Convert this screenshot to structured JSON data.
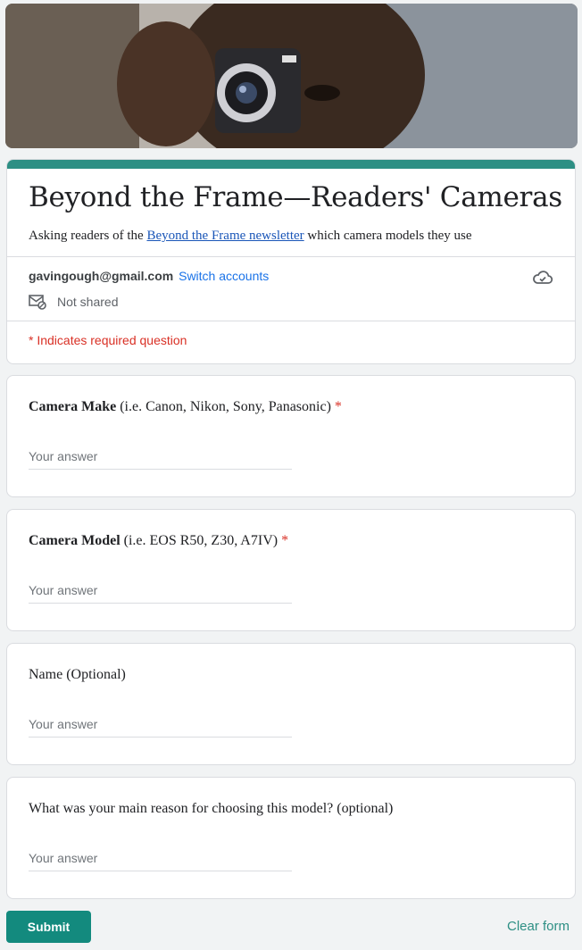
{
  "header": {
    "title": "Beyond the Frame—Readers' Cameras",
    "description_prefix": "Asking readers of the ",
    "description_link": "Beyond the Frame newsletter",
    "description_suffix": " which camera models they use",
    "accent_color": "#2d8f84"
  },
  "account": {
    "email": "gavingough@gmail.com",
    "switch_label": "Switch accounts",
    "shared_status": "Not shared",
    "cloud_icon": "cloud-check-icon"
  },
  "required_note": "* Indicates required question",
  "questions": [
    {
      "label_bold": "Camera Make",
      "label_rest": " (i.e. Canon, Nikon, Sony, Panasonic)",
      "required_mark": "*",
      "placeholder": "Your answer"
    },
    {
      "label_bold": "Camera Model",
      "label_rest": " (i.e. EOS R50, Z30, A7IV)",
      "required_mark": "*",
      "placeholder": "Your answer"
    },
    {
      "label_bold": "",
      "label_rest": "Name (Optional)",
      "required_mark": "",
      "placeholder": "Your answer"
    },
    {
      "label_bold": "",
      "label_rest": "What was your main reason for choosing this model? (optional)",
      "required_mark": "",
      "placeholder": "Your answer"
    }
  ],
  "actions": {
    "submit_label": "Submit",
    "clear_label": "Clear form"
  }
}
